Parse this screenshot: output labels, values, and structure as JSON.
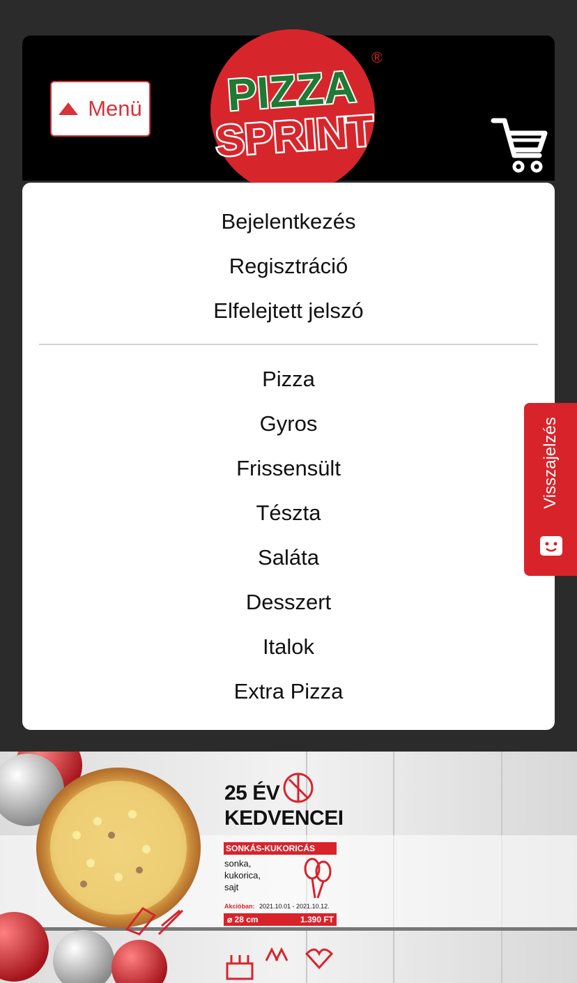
{
  "header": {
    "menu_label": "Menü",
    "brand_top": "PIZZA",
    "brand_bottom": "SPRINT",
    "registered": "®"
  },
  "account_links": [
    "Bejelentkezés",
    "Regisztráció",
    "Elfelejtett jelszó"
  ],
  "categories": [
    "Pizza",
    "Gyros",
    "Frissensült",
    "Tészta",
    "Saláta",
    "Desszert",
    "Italok",
    "Extra Pizza"
  ],
  "feedback": {
    "label": "Visszajelzés"
  },
  "banner": {
    "title_line1": "25 ÉV",
    "title_line2": "KEDVENCEI",
    "product_name": "SONKÁS-KUKORICÁS PIZZA",
    "ingredients": [
      "sonka,",
      "kukorica,",
      "sajt"
    ],
    "promo_label": "Akcióban:",
    "promo_dates": "2021.10.01 - 2021.10.12.",
    "size": "⌀ 28 cm",
    "price": "1.390 FT"
  },
  "colors": {
    "brand_red": "#d8323b",
    "background": "#2b2b2b"
  }
}
